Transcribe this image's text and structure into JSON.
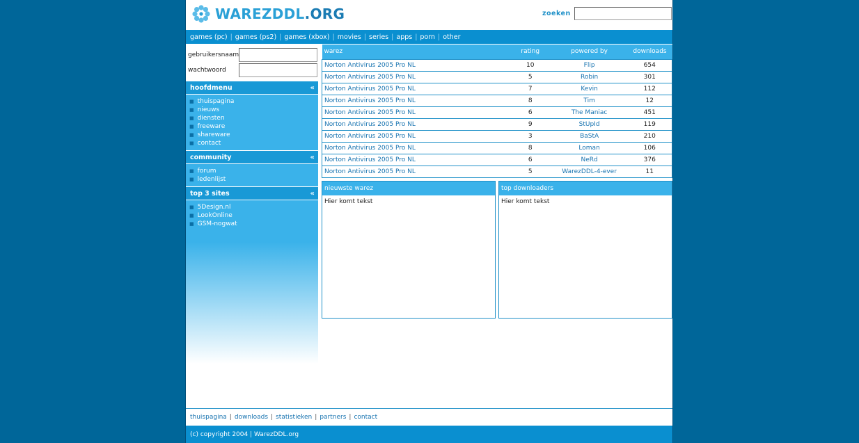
{
  "header": {
    "logo_main": "WAREZDDL",
    "logo_suffix": ".ORG",
    "search_label": "zoeken",
    "search_value": ""
  },
  "nav": {
    "items": [
      "games (pc)",
      "games (ps2)",
      "games (xbox)",
      "movies",
      "series",
      "apps",
      "porn",
      "other"
    ]
  },
  "login": {
    "username_label": "gebruikersnaam",
    "password_label": "wachtwoord"
  },
  "sidebar": {
    "chevron": "«",
    "sections": [
      {
        "title": "hoofdmenu",
        "items": [
          "thuispagina",
          "nieuws",
          "diensten",
          "freeware",
          "shareware",
          "contact"
        ]
      },
      {
        "title": "community",
        "items": [
          "forum",
          "ledenlijst"
        ]
      },
      {
        "title": "top 3 sites",
        "items": [
          "5Design.nl",
          "LookOnline",
          "GSM-nogwat"
        ]
      }
    ]
  },
  "warez_table": {
    "headers": [
      "warez",
      "rating",
      "powered by",
      "downloads"
    ],
    "rows": [
      [
        "Norton Antivirus 2005 Pro NL",
        "10",
        "Flip",
        "654"
      ],
      [
        "Norton Antivirus 2005 Pro NL",
        "5",
        "Robin",
        "301"
      ],
      [
        "Norton Antivirus 2005 Pro NL",
        "7",
        "Kevin",
        "112"
      ],
      [
        "Norton Antivirus 2005 Pro NL",
        "8",
        "Tim",
        "12"
      ],
      [
        "Norton Antivirus 2005 Pro NL",
        "6",
        "The Maniac",
        "451"
      ],
      [
        "Norton Antivirus 2005 Pro NL",
        "9",
        "StUpId",
        "119"
      ],
      [
        "Norton Antivirus 2005 Pro NL",
        "3",
        "BaStA",
        "210"
      ],
      [
        "Norton Antivirus 2005 Pro NL",
        "8",
        "Loman",
        "106"
      ],
      [
        "Norton Antivirus 2005 Pro NL",
        "6",
        "NeRd",
        "376"
      ],
      [
        "Norton Antivirus 2005 Pro NL",
        "5",
        "WarezDDL-4-ever",
        "11"
      ]
    ]
  },
  "boxes": {
    "newest": {
      "title": "nieuwste warez",
      "body": "Hier komt tekst"
    },
    "top_downloaders": {
      "title": "top downloaders",
      "body": "Hier komt tekst"
    }
  },
  "footer": {
    "links": [
      "thuispagina",
      "downloads",
      "statistieken",
      "partners",
      "contact"
    ],
    "copyright": "(c) copyright 2004 | WarezDDL.org"
  },
  "colors": {
    "background": "#006699",
    "nav": "#0a8fd0",
    "accent": "#3ab2ea",
    "link": "#1773b0"
  }
}
